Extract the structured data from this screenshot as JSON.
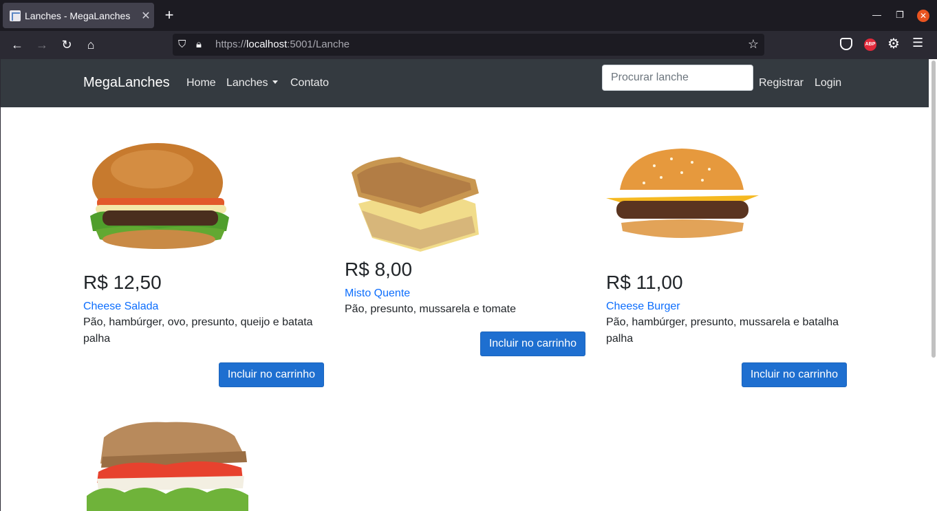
{
  "browser": {
    "tab_title": "Lanches - MegaLanches",
    "url_scheme": "https://",
    "url_host": "localhost",
    "url_rest": ":5001/Lanche",
    "extensions": {
      "abp_label": "ABP"
    }
  },
  "site": {
    "brand": "MegaLanches",
    "nav": {
      "home": "Home",
      "lanches": "Lanches",
      "contato": "Contato"
    },
    "search_placeholder": "Procurar lanche",
    "register": "Registrar",
    "login": "Login"
  },
  "products": [
    {
      "price": "R$ 12,50",
      "name": "Cheese Salada",
      "desc": "Pão, hambúrger, ovo, presunto, queijo e batata palha",
      "button": "Incluir no carrinho"
    },
    {
      "price": "R$ 8,00",
      "name": "Misto Quente",
      "desc": "Pão, presunto, mussarela e tomate",
      "button": "Incluir no carrinho"
    },
    {
      "price": "R$ 11,00",
      "name": "Cheese Burger",
      "desc": "Pão, hambúrger, presunto, mussarela e batalha palha",
      "button": "Incluir no carrinho"
    }
  ],
  "colors": {
    "navbar": "#343a40",
    "link": "#0d6efd",
    "button": "#1e6fd0"
  }
}
